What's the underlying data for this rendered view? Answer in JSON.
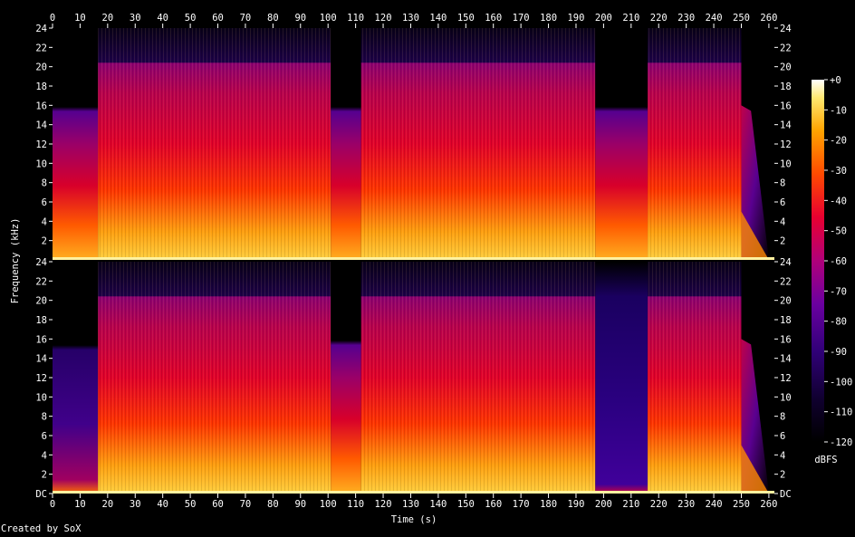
{
  "chart_data": {
    "type": "heatmap",
    "title": "",
    "xlabel": "Time (s)",
    "ylabel": "Frequency (kHz)",
    "xlim": [
      0,
      262
    ],
    "ylim": [
      0,
      24
    ],
    "x_ticks": [
      0,
      10,
      20,
      30,
      40,
      50,
      60,
      70,
      80,
      90,
      100,
      110,
      120,
      130,
      140,
      150,
      160,
      170,
      180,
      190,
      200,
      210,
      220,
      230,
      240,
      250,
      260
    ],
    "y_ticks": [
      0,
      2,
      4,
      6,
      8,
      10,
      12,
      14,
      16,
      18,
      20,
      22,
      24
    ],
    "y_tick_labels": [
      "DC",
      "2",
      "4",
      "6",
      "8",
      "10",
      "12",
      "14",
      "16",
      "18",
      "20",
      "22",
      "24"
    ],
    "channels": [
      {
        "channel": 1,
        "segments": [
          {
            "start": 0,
            "end": 16.5,
            "max_freq_khz": 15.5,
            "level": "medium"
          },
          {
            "start": 16.5,
            "end": 101,
            "max_freq_khz": 20.5,
            "level": "loud"
          },
          {
            "start": 101,
            "end": 112,
            "max_freq_khz": 15.5,
            "level": "medium"
          },
          {
            "start": 112,
            "end": 197,
            "max_freq_khz": 20.5,
            "level": "loud"
          },
          {
            "start": 197,
            "end": 216,
            "max_freq_khz": 16,
            "level": "medium"
          },
          {
            "start": 216,
            "end": 250,
            "max_freq_khz": 20.5,
            "level": "loud"
          },
          {
            "start": 250,
            "end": 260,
            "max_freq_khz": 16,
            "level": "fade"
          }
        ]
      },
      {
        "channel": 2,
        "segments": [
          {
            "start": 0,
            "end": 16.5,
            "max_freq_khz": 15,
            "level": "quiet"
          },
          {
            "start": 16.5,
            "end": 101,
            "max_freq_khz": 20.5,
            "level": "loud"
          },
          {
            "start": 101,
            "end": 112,
            "max_freq_khz": 16,
            "level": "medium"
          },
          {
            "start": 112,
            "end": 197,
            "max_freq_khz": 20.5,
            "level": "loud"
          },
          {
            "start": 197,
            "end": 216,
            "max_freq_khz": 20.5,
            "level": "very-quiet"
          },
          {
            "start": 216,
            "end": 250,
            "max_freq_khz": 20.5,
            "level": "loud"
          },
          {
            "start": 250,
            "end": 260,
            "max_freq_khz": 16,
            "level": "fade"
          }
        ]
      }
    ],
    "colorbar": {
      "label": "dBFS",
      "range": [
        -120,
        0
      ],
      "tick_labels": [
        "+0",
        "-10",
        "-20",
        "-30",
        "-40",
        "-50",
        "-60",
        "-70",
        "-80",
        "-90",
        "-100",
        "-110",
        "-120"
      ]
    }
  },
  "footer": {
    "credit": "Created by SoX"
  },
  "colors": {
    "background": "#000000",
    "text": "#ffffff"
  }
}
